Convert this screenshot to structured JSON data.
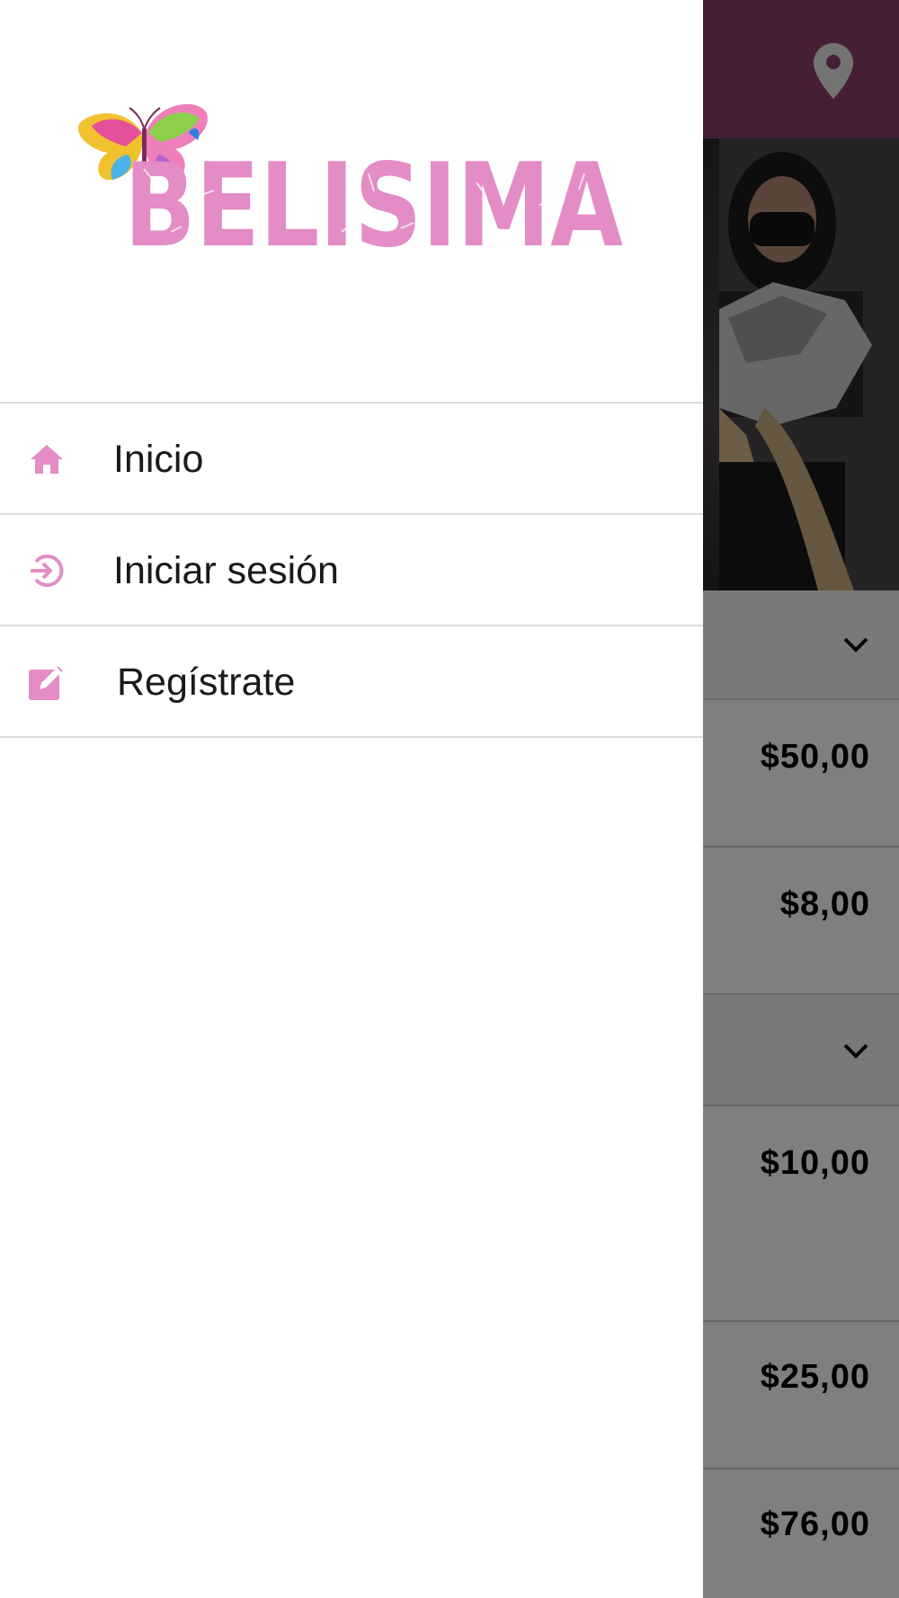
{
  "colors": {
    "brand_pink": "#e38cc5",
    "header_plum": "#8d3e6f",
    "accent_dot": "#c2609e"
  },
  "header": {
    "location_icon": "map-pin-icon"
  },
  "carousel": {
    "slide_count": 2,
    "active_slide": 1
  },
  "services": [
    {
      "type": "category",
      "icon": "chevron-down-icon"
    },
    {
      "type": "item",
      "price": "$50,00"
    },
    {
      "type": "item",
      "price": "$8,00"
    },
    {
      "type": "category",
      "icon": "chevron-down-icon"
    },
    {
      "type": "item",
      "price": "$10,00"
    },
    {
      "type": "item",
      "price": "$25,00"
    },
    {
      "type": "item",
      "price": "$76,00"
    }
  ],
  "drawer": {
    "logo": {
      "text": "BELISIMA",
      "icon": "butterfly-logo-icon"
    },
    "items": [
      {
        "label": "Inicio",
        "icon": "home-icon"
      },
      {
        "label": "Iniciar sesión",
        "icon": "login-icon"
      },
      {
        "label": "Regístrate",
        "icon": "edit-icon"
      }
    ]
  }
}
